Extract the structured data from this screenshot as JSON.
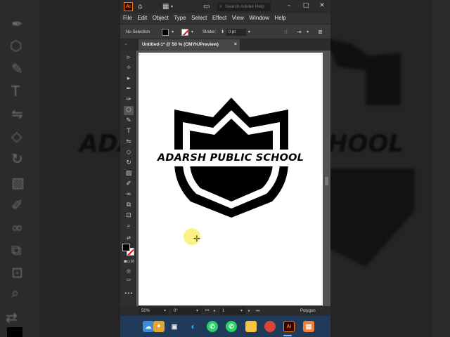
{
  "app": {
    "logo_text": "Ai",
    "search_placeholder": "Search Adobe Help"
  },
  "menu": [
    "File",
    "Edit",
    "Object",
    "Type",
    "Select",
    "Effect",
    "View",
    "Window",
    "Help"
  ],
  "control_bar": {
    "selection_label": "No Selection",
    "stroke_label": "Stroke:",
    "stroke_value": "0 pt"
  },
  "document_tab": {
    "label": "Untitled-1* @ 50 % (CMYK/Preview)",
    "close": "×"
  },
  "artwork": {
    "school_name": "ADARSH PUBLIC SCHOOL",
    "shield_color": "#000000"
  },
  "background_text": {
    "left": "ADA",
    "right": "HOOL"
  },
  "status_bar": {
    "zoom": "50%",
    "rotation": "0°",
    "artboard_number": "1",
    "current_tool": "Polygon"
  },
  "taskbar": {
    "apps": [
      "widgets-icon",
      "file-explorer-icon",
      "edge-icon",
      "whatsapp-icon",
      "whatsapp-icon",
      "folder-icon",
      "chrome-icon",
      "illustrator-icon",
      "paint-icon"
    ],
    "illustrator_label": "Ai"
  },
  "colors": {
    "accent_orange": "#ff7c00",
    "taskbar": "#203a59",
    "cursor_highlight": "#fcf06e"
  }
}
